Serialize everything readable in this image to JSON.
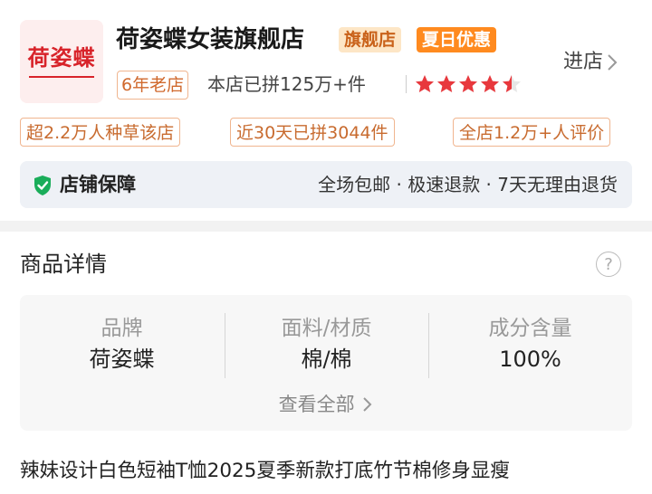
{
  "store": {
    "logo_text": "荷姿蝶",
    "name": "荷姿蝶女装旗舰店",
    "badge_flagship": "旗舰店",
    "badge_promo": "夏日优惠",
    "enter_label": "进店",
    "years_badge": "6年老店",
    "sold_text": "本店已拼125万+件",
    "rating_stars": 4.5,
    "tags": [
      "超2.2万人种草该店",
      "近30天已拼3044件",
      "全店1.2万+人评价"
    ],
    "guarantee_title": "店铺保障",
    "guarantee_items": "全场包邮 · 极速退款 · 7天无理由退货"
  },
  "details": {
    "title": "商品详情",
    "help_icon": "?",
    "specs": [
      {
        "label": "品牌",
        "value": "荷姿蝶"
      },
      {
        "label": "面料/材质",
        "value": "棉/棉"
      },
      {
        "label": "成分含量",
        "value": "100%"
      }
    ],
    "view_all": "查看全部"
  },
  "product_title": "辣妹设计白色短袖T恤2025夏季新款打底竹节棉修身显瘦",
  "colors": {
    "brand_red": "#d8232a",
    "star_red": "#e8383d",
    "tag_orange": "#c86b2f",
    "promo_orange": "#ff8a1f",
    "shield_green": "#1aad5a"
  }
}
